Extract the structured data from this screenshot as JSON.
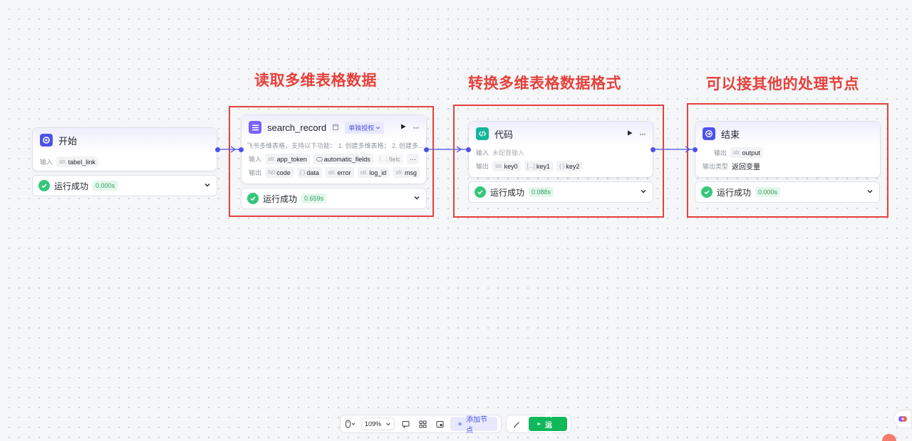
{
  "annotations": {
    "read": "读取多维表格数据",
    "convert": "转换多维表格数据格式",
    "other": "可以接其他的处理节点"
  },
  "start_node": {
    "title": "开始",
    "input_label": "输入",
    "input_param": {
      "type": "str.",
      "name": "tabel_link"
    },
    "status_text": "运行成功",
    "status_time": "0.000s"
  },
  "search_node": {
    "title": "search_record",
    "auth_badge": "单独授权",
    "description": "飞书多维表格，支持以下功能：  1. 创建多维表格；  2. 创建多...",
    "input_label": "输入",
    "inputs": [
      {
        "type": "str.",
        "name": "app_token"
      },
      {
        "type": "",
        "name": "automatic_fields"
      },
      {
        "type": "[...]",
        "name": "fielc"
      }
    ],
    "more": "···",
    "output_label": "输出",
    "outputs": [
      {
        "type": "N0",
        "name": "code"
      },
      {
        "type": "{ }",
        "name": "data"
      },
      {
        "type": "str.",
        "name": "error"
      },
      {
        "type": "str.",
        "name": "log_id"
      },
      {
        "type": "str.",
        "name": "msg"
      }
    ],
    "status_text": "运行成功",
    "status_time": "0.659s"
  },
  "code_node": {
    "title": "代码",
    "input_label": "输入",
    "input_placeholder": "未配置输入",
    "output_label": "输出",
    "outputs": [
      {
        "type": "str.",
        "name": "key0"
      },
      {
        "type": "[...]",
        "name": "key1"
      },
      {
        "type": "{ }",
        "name": "key2"
      }
    ],
    "status_text": "运行成功",
    "status_time": "0.088s"
  },
  "end_node": {
    "title": "结束",
    "output_label": "输出",
    "output_param": {
      "type": "str.",
      "name": "output"
    },
    "output_type_label": "输出类型",
    "output_type_value": "返回变量",
    "status_text": "运行成功",
    "status_time": "0.000s"
  },
  "toolbar": {
    "zoom": "109%",
    "add_node": "添加节点",
    "test_run": "试运行"
  },
  "colors": {
    "accent": "#4d53e8",
    "annotation_red": "#e5413b",
    "success": "#34c77b",
    "run_green": "#0fb85a"
  }
}
